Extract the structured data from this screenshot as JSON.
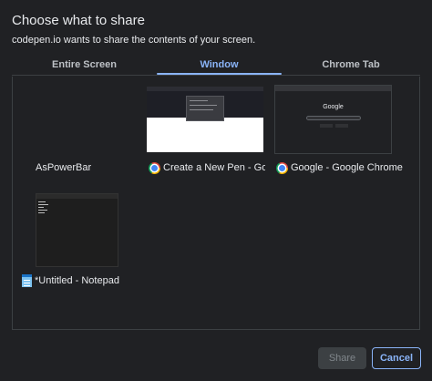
{
  "dialog": {
    "title": "Choose what to share",
    "subtitle": "codepen.io wants to share the contents of your screen."
  },
  "tabs": [
    {
      "label": "Entire Screen",
      "selected": false
    },
    {
      "label": "Window",
      "selected": true
    },
    {
      "label": "Chrome Tab",
      "selected": false
    }
  ],
  "windows": [
    {
      "label": "AsPowerBar",
      "icon": "none"
    },
    {
      "label": "Create a New Pen - Goo",
      "icon": "chrome-icon"
    },
    {
      "label": "Google - Google Chrome",
      "icon": "chrome-icon"
    },
    {
      "label": "*Untitled - Notepad",
      "icon": "notepad-icon"
    }
  ],
  "google_logo_text": "Google",
  "buttons": {
    "share": "Share",
    "cancel": "Cancel"
  },
  "colors": {
    "background": "#202124",
    "accent": "#8ab4f8",
    "border": "#3c4043"
  }
}
